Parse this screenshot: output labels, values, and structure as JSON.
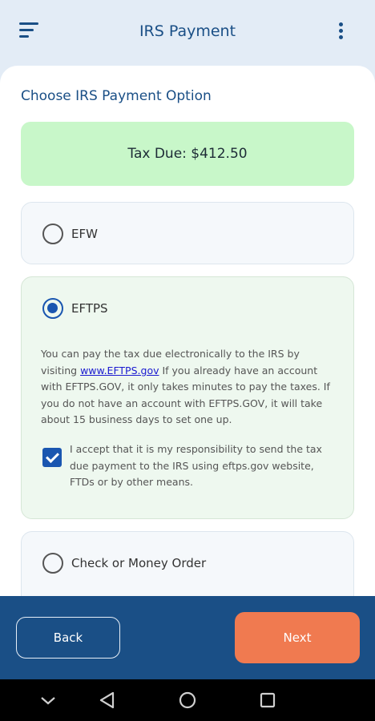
{
  "header": {
    "title": "IRS Payment"
  },
  "section": {
    "title": "Choose IRS Payment Option"
  },
  "tax_due": {
    "text": "Tax Due: $412.50"
  },
  "options": {
    "efw": {
      "label": "EFW",
      "selected": false
    },
    "eftps": {
      "label": "EFTPS",
      "selected": true,
      "desc_before": "You can pay the tax due electronically to the IRS by visiting ",
      "link": "www.EFTPS.gov",
      "desc_after": " If you already have an account with EFTPS.GOV, it only takes minutes to pay the taxes. If you do not have an account with EFTPS.GOV, it will take about 15 business days to set one up.",
      "accept_text": "I accept that it is my responsibility to send the tax due payment to the IRS using eftps.gov website, FTDs or by other means.",
      "accept_checked": true
    },
    "check": {
      "label": "Check or Money Order",
      "selected": false
    }
  },
  "footer": {
    "back_label": "Back",
    "next_label": "Next"
  },
  "colors": {
    "primary": "#1a4f86",
    "accent": "#f07a50",
    "tax_bg": "#c8f7c9",
    "radio": "#1a56b0"
  },
  "icons": {
    "menu": "menu-icon",
    "more": "more-vertical-icon",
    "nav_down": "chevron-down-icon",
    "nav_back": "triangle-back-icon",
    "nav_home": "circle-home-icon",
    "nav_recent": "square-recent-icon"
  }
}
